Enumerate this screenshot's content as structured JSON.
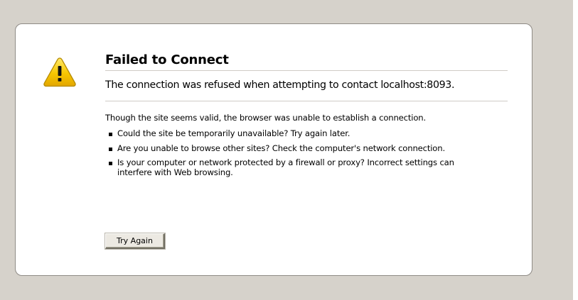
{
  "error": {
    "icon": "warning-triangle-icon",
    "title": "Failed to Connect",
    "short_desc": "The connection was refused when attempting to contact localhost:8093.",
    "long_desc_intro": "Though the site seems valid, the browser was unable to establish a connection.",
    "bullets": [
      "Could the site be temporarily unavailable? Try again later.",
      "Are you unable to browse other sites? Check the computer's network connection.",
      "Is your computer or network protected by a firewall or proxy? Incorrect settings can interfere with Web browsing."
    ],
    "try_again_label": "Try Again"
  },
  "colors": {
    "page_background": "#d6d2cb",
    "box_border": "#8f8b86",
    "warning_fill": "#f5c400",
    "divider": "#d0ccc6"
  }
}
